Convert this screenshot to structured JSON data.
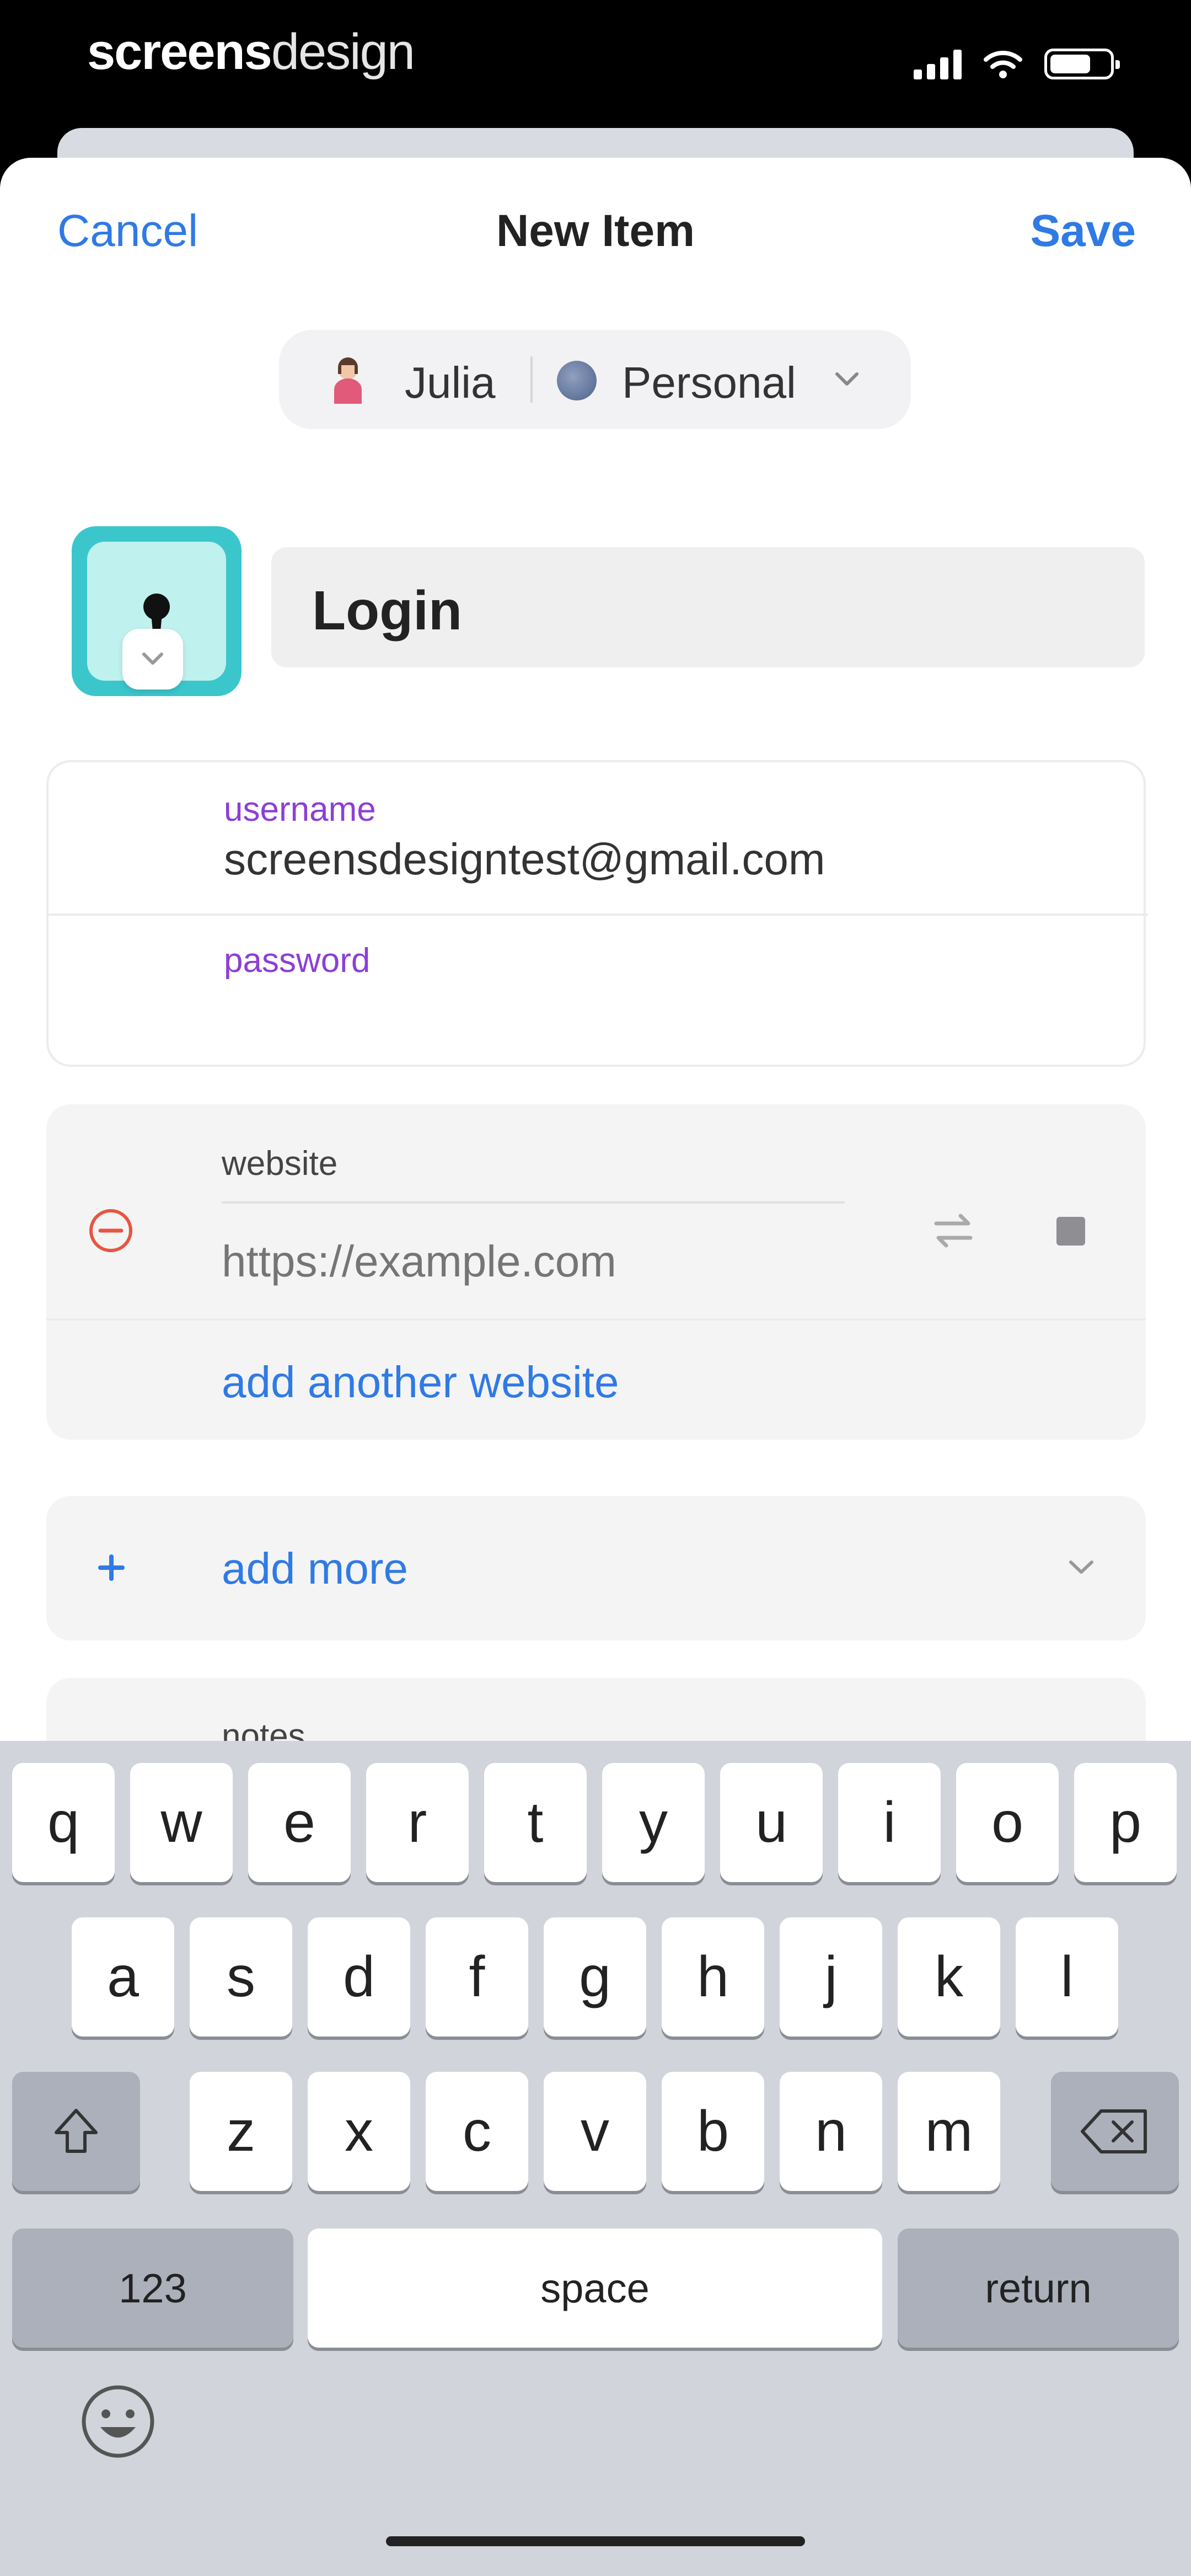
{
  "status_bar": {
    "brand_bold": "screens",
    "brand_light": "design"
  },
  "nav": {
    "cancel": "Cancel",
    "title": "New Item",
    "save": "Save"
  },
  "vault_selector": {
    "user": "Julia",
    "vault": "Personal"
  },
  "item": {
    "title": "Login"
  },
  "login_fields": {
    "username_label": "username",
    "username_value": "screensdesigntest@gmail.com",
    "password_label": "password"
  },
  "website": {
    "label": "website",
    "placeholder": "https://example.com",
    "add_another": "add another website"
  },
  "add_more": {
    "label": "add more"
  },
  "notes": {
    "label": "notes"
  },
  "keyboard": {
    "row1": [
      "q",
      "w",
      "e",
      "r",
      "t",
      "y",
      "u",
      "i",
      "o",
      "p"
    ],
    "row2": [
      "a",
      "s",
      "d",
      "f",
      "g",
      "h",
      "j",
      "k",
      "l"
    ],
    "row3": [
      "z",
      "x",
      "c",
      "v",
      "b",
      "n",
      "m"
    ],
    "numbers": "123",
    "space": "space",
    "return": "return"
  },
  "colors": {
    "accent": "#2f7ae5",
    "field_label": "#8c3fd6",
    "remove": "#e8553f",
    "icon_teal": "#3bc6cc",
    "keyboard_bg": "#d1d4db"
  },
  "icons": [
    "signal-icon",
    "wifi-icon",
    "battery-icon",
    "avatar-icon",
    "vault-icon",
    "chevron-down-icon",
    "keyhole-icon",
    "remove-circle-icon",
    "swap-icon",
    "stop-icon",
    "plus-icon",
    "shift-icon",
    "backspace-icon",
    "emoji-icon"
  ]
}
